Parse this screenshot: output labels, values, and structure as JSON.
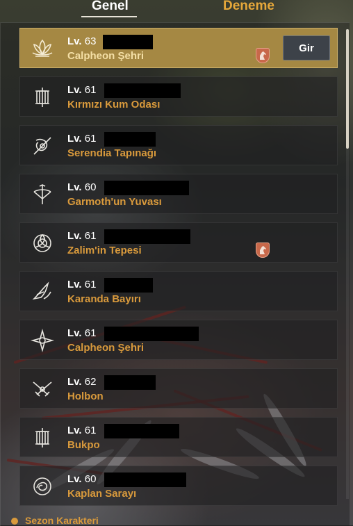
{
  "tabs": [
    {
      "label": "Genel",
      "active": true
    },
    {
      "label": "Deneme",
      "active": false
    }
  ],
  "enter_button_label": "Gir",
  "characters": [
    {
      "level_prefix": "Lv.",
      "level": "63",
      "location": "Calpheon Şehri",
      "icon": "lotus-class-icon",
      "selected": true,
      "has_horse": true
    },
    {
      "level_prefix": "Lv.",
      "level": "61",
      "location": "Kırmızı Kum Odası",
      "icon": "lantern-class-icon",
      "selected": false,
      "has_horse": false
    },
    {
      "level_prefix": "Lv.",
      "level": "61",
      "location": "Serendia Tapınağı",
      "icon": "crossed-blades-class-icon",
      "selected": false,
      "has_horse": false
    },
    {
      "level_prefix": "Lv.",
      "level": "60",
      "location": "Garmoth'un Yuvası",
      "icon": "bow-class-icon",
      "selected": false,
      "has_horse": false
    },
    {
      "level_prefix": "Lv.",
      "level": "61",
      "location": "Zalim'in Tepesi",
      "icon": "rose-class-icon",
      "selected": false,
      "has_horse": true
    },
    {
      "level_prefix": "Lv.",
      "level": "61",
      "location": "Karanda Bayırı",
      "icon": "wing-class-icon",
      "selected": false,
      "has_horse": false
    },
    {
      "level_prefix": "Lv.",
      "level": "61",
      "location": "Calpheon Şehri",
      "icon": "star-blade-class-icon",
      "selected": false,
      "has_horse": false
    },
    {
      "level_prefix": "Lv.",
      "level": "62",
      "location": "Holbon",
      "icon": "crossed-guns-class-icon",
      "selected": false,
      "has_horse": false
    },
    {
      "level_prefix": "Lv.",
      "level": "61",
      "location": "Bukpo",
      "icon": "lantern-class-icon",
      "selected": false,
      "has_horse": false
    },
    {
      "level_prefix": "Lv.",
      "level": "60",
      "location": "Kaplan Sarayı",
      "icon": "swirl-orb-class-icon",
      "selected": false,
      "has_horse": false
    }
  ],
  "section_footer": "Sezon Karakteri",
  "colors": {
    "selected_row": "#a58843",
    "location_text": "#d99a3c",
    "inactive_tab": "#e7a83a",
    "horse_badge": "#c8684a"
  }
}
